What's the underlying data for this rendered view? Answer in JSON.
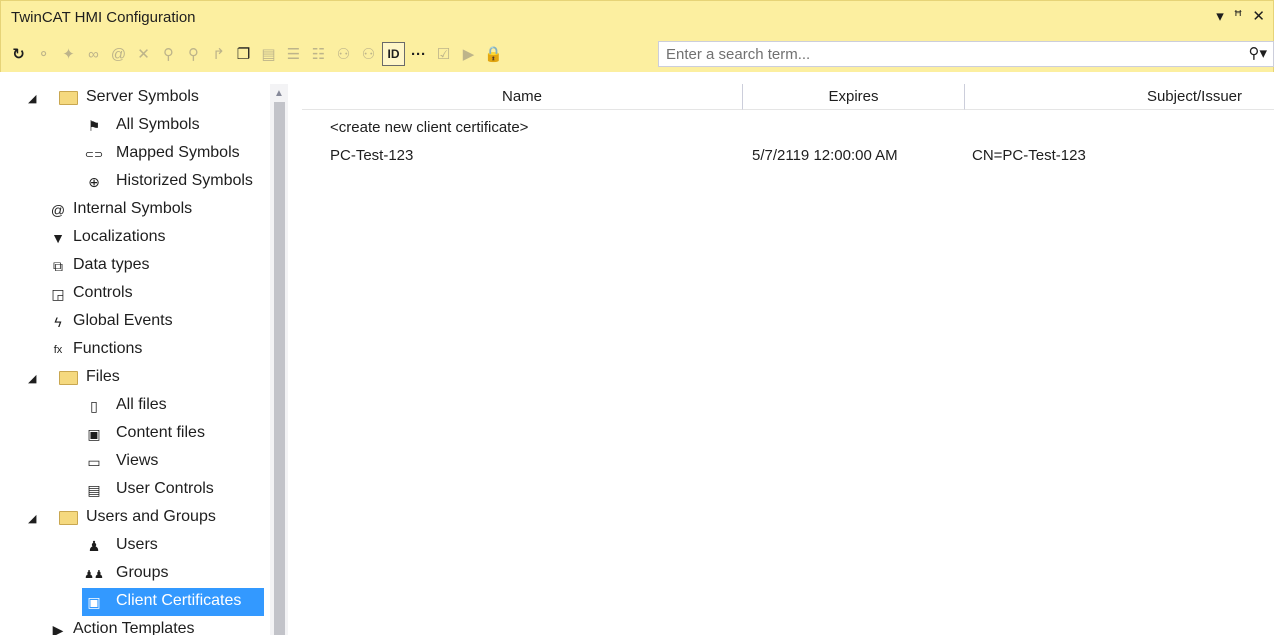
{
  "window": {
    "title": "TwinCAT HMI Configuration",
    "controls": [
      "▾",
      "ꟸ",
      "✕"
    ]
  },
  "toolbar": {
    "buttons": [
      {
        "icon": "refresh-icon",
        "glyph": "↻",
        "enabled": true
      },
      {
        "icon": "add-symbol-icon",
        "glyph": "⚬",
        "enabled": false
      },
      {
        "icon": "map-symbol-icon",
        "glyph": "✦",
        "enabled": false
      },
      {
        "icon": "link-icon",
        "glyph": "∞",
        "enabled": false
      },
      {
        "icon": "at-icon",
        "glyph": "@",
        "enabled": false
      },
      {
        "icon": "delete-icon",
        "glyph": "✕",
        "enabled": false
      },
      {
        "icon": "user-symbol-icon",
        "glyph": "⚲",
        "enabled": false
      },
      {
        "icon": "group-symbol-icon",
        "glyph": "⚲",
        "enabled": false
      },
      {
        "icon": "arrow-symbol-icon",
        "glyph": "↱",
        "enabled": false
      },
      {
        "icon": "copy-icon",
        "glyph": "❐",
        "enabled": true
      },
      {
        "icon": "folder-symbol-icon",
        "glyph": "▤",
        "enabled": false
      },
      {
        "icon": "list-icon",
        "glyph": "☰",
        "enabled": false
      },
      {
        "icon": "list-alt-icon",
        "glyph": "☷",
        "enabled": false
      },
      {
        "icon": "users-icon",
        "glyph": "⚇",
        "enabled": false
      },
      {
        "icon": "user-alt-icon",
        "glyph": "⚇",
        "enabled": false
      },
      {
        "icon": "id-icon",
        "glyph": "ID",
        "enabled": true,
        "selected": true
      },
      {
        "icon": "more-icon",
        "glyph": "···",
        "enabled": true
      },
      {
        "icon": "checkbox-icon",
        "glyph": "☑",
        "enabled": false
      },
      {
        "icon": "play-icon",
        "glyph": "▶",
        "enabled": false
      },
      {
        "icon": "lock-icon",
        "glyph": "🔒",
        "enabled": true
      }
    ]
  },
  "search": {
    "placeholder": "Enter a search term...",
    "value": "",
    "icon": "search-icon"
  },
  "tree": {
    "items": [
      {
        "label": "Server Symbols",
        "level": 0,
        "expanded": true,
        "icon": "folder-icon"
      },
      {
        "label": "All Symbols",
        "level": 1,
        "icon": "all-symbols-icon",
        "glyph": "⚑"
      },
      {
        "label": "Mapped Symbols",
        "level": 1,
        "icon": "mapped-symbols-icon",
        "glyph": "⊂⊃"
      },
      {
        "label": "Historized Symbols",
        "level": 1,
        "icon": "historized-symbols-icon",
        "glyph": "⊕"
      },
      {
        "label": "Internal Symbols",
        "level": 0,
        "icon": "internal-symbols-icon",
        "glyph": "@"
      },
      {
        "label": "Localizations",
        "level": 0,
        "icon": "localizations-icon",
        "glyph": "▼"
      },
      {
        "label": "Data types",
        "level": 0,
        "icon": "data-types-icon",
        "glyph": "⧉"
      },
      {
        "label": "Controls",
        "level": 0,
        "icon": "controls-icon",
        "glyph": "◲"
      },
      {
        "label": "Global Events",
        "level": 0,
        "icon": "global-events-icon",
        "glyph": "ϟ"
      },
      {
        "label": "Functions",
        "level": 0,
        "icon": "functions-icon",
        "glyph": "fx"
      },
      {
        "label": "Files",
        "level": 0,
        "expanded": true,
        "icon": "folder-icon"
      },
      {
        "label": "All files",
        "level": 1,
        "icon": "all-files-icon",
        "glyph": "▯"
      },
      {
        "label": "Content files",
        "level": 1,
        "icon": "content-files-icon",
        "glyph": "▣"
      },
      {
        "label": "Views",
        "level": 1,
        "icon": "views-icon",
        "glyph": "▭"
      },
      {
        "label": "User Controls",
        "level": 1,
        "icon": "user-controls-icon",
        "glyph": "▤"
      },
      {
        "label": "Users and Groups",
        "level": 0,
        "expanded": true,
        "icon": "folder-icon"
      },
      {
        "label": "Users",
        "level": 1,
        "icon": "users-icon",
        "glyph": "♟"
      },
      {
        "label": "Groups",
        "level": 1,
        "icon": "groups-icon",
        "glyph": "♟♟"
      },
      {
        "label": "Client Certificates",
        "level": 1,
        "icon": "client-certificates-icon",
        "glyph": "▣",
        "selected": true
      },
      {
        "label": "Action Templates",
        "level": 0,
        "icon": "action-templates-icon",
        "glyph": "▶"
      }
    ]
  },
  "grid": {
    "columns": [
      "Name",
      "Expires",
      "Subject/Issuer"
    ],
    "rows": [
      {
        "name": "<create new client certificate>",
        "expires": "",
        "subject": ""
      },
      {
        "name": "PC-Test-123",
        "expires": "5/7/2119 12:00:00 AM",
        "subject": "CN=PC-Test-123"
      }
    ]
  },
  "colors": {
    "title_bar": "#fcefa0",
    "selection": "#3399ff",
    "folder": "#f5d97f"
  }
}
